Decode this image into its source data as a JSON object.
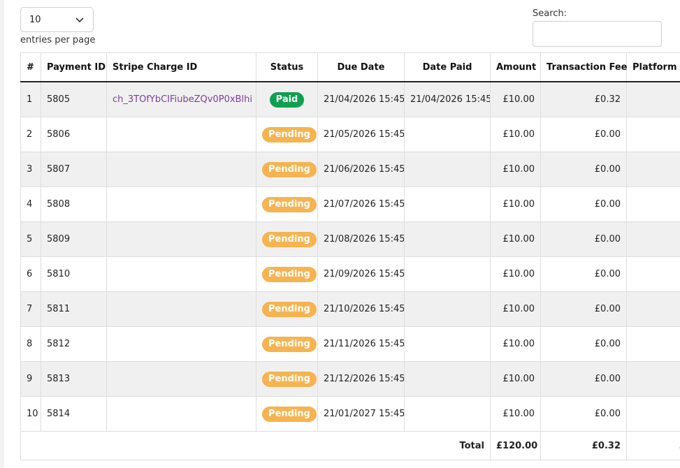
{
  "controls": {
    "page_length_value": "10",
    "entries_label": "entries per page",
    "search_label": "Search:",
    "search_value": ""
  },
  "table": {
    "headers": [
      "#",
      "Payment ID",
      "Stripe Charge ID",
      "Status",
      "Due Date",
      "Date Paid",
      "Amount",
      "Transaction Fee",
      "Platform"
    ],
    "rows": [
      {
        "num": "1",
        "payment_id": "5805",
        "charge_id": "ch_3TOfYbCIFiubeZQv0P0xBlhi",
        "status": "Paid",
        "due": "21/04/2026 15:45",
        "paid": "21/04/2026 15:45",
        "amount": "£10.00",
        "fee": "£0.32",
        "platform": "£"
      },
      {
        "num": "2",
        "payment_id": "5806",
        "charge_id": "",
        "status": "Pending",
        "due": "21/05/2026 15:45",
        "paid": "",
        "amount": "£10.00",
        "fee": "£0.00",
        "platform": "£"
      },
      {
        "num": "3",
        "payment_id": "5807",
        "charge_id": "",
        "status": "Pending",
        "due": "21/06/2026 15:45",
        "paid": "",
        "amount": "£10.00",
        "fee": "£0.00",
        "platform": "£"
      },
      {
        "num": "4",
        "payment_id": "5808",
        "charge_id": "",
        "status": "Pending",
        "due": "21/07/2026 15:45",
        "paid": "",
        "amount": "£10.00",
        "fee": "£0.00",
        "platform": "£"
      },
      {
        "num": "5",
        "payment_id": "5809",
        "charge_id": "",
        "status": "Pending",
        "due": "21/08/2026 15:45",
        "paid": "",
        "amount": "£10.00",
        "fee": "£0.00",
        "platform": "£"
      },
      {
        "num": "6",
        "payment_id": "5810",
        "charge_id": "",
        "status": "Pending",
        "due": "21/09/2026 15:45",
        "paid": "",
        "amount": "£10.00",
        "fee": "£0.00",
        "platform": "£"
      },
      {
        "num": "7",
        "payment_id": "5811",
        "charge_id": "",
        "status": "Pending",
        "due": "21/10/2026 15:45",
        "paid": "",
        "amount": "£10.00",
        "fee": "£0.00",
        "platform": "£"
      },
      {
        "num": "8",
        "payment_id": "5812",
        "charge_id": "",
        "status": "Pending",
        "due": "21/11/2026 15:45",
        "paid": "",
        "amount": "£10.00",
        "fee": "£0.00",
        "platform": "£"
      },
      {
        "num": "9",
        "payment_id": "5813",
        "charge_id": "",
        "status": "Pending",
        "due": "21/12/2026 15:45",
        "paid": "",
        "amount": "£10.00",
        "fee": "£0.00",
        "platform": "£"
      },
      {
        "num": "10",
        "payment_id": "5814",
        "charge_id": "",
        "status": "Pending",
        "due": "21/01/2027 15:45",
        "paid": "",
        "amount": "£10.00",
        "fee": "£0.00",
        "platform": "£"
      }
    ],
    "footer": {
      "label": "Total",
      "amount": "£120.00",
      "fee": "£0.32",
      "platform": "£"
    }
  },
  "colors": {
    "paid_badge": "#0e9f4f",
    "pending_badge": "#f5b451",
    "charge_link": "#7b3f9e",
    "row_stripe": "#f0f0f0"
  },
  "icons": {
    "length_select": "chevron-down-icon"
  }
}
